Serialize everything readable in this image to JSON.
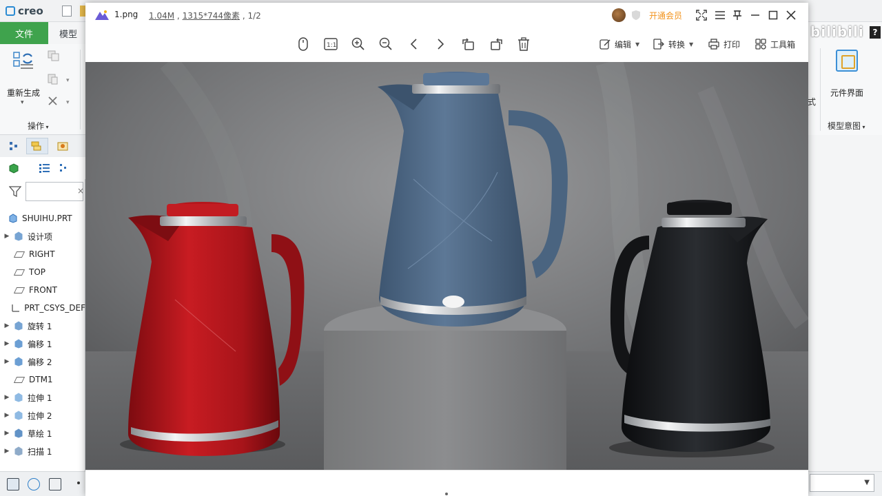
{
  "creo": {
    "app_name": "creo",
    "tabs": {
      "file": "文件",
      "model": "模型"
    },
    "ribbon": {
      "regenerate": "重新生成",
      "operations_group": "操作",
      "component_interface": "元件界面",
      "model_intent": "模型意图",
      "partial_label": "式"
    },
    "watermark": "bilibili",
    "help": "?",
    "tree": {
      "filter_placeholder": "",
      "root": "SHUIHU.PRT",
      "items": [
        {
          "label": "设计项",
          "expandable": true,
          "icon": "design-items-icon"
        },
        {
          "label": "RIGHT",
          "expandable": false,
          "icon": "datum-plane-icon"
        },
        {
          "label": "TOP",
          "expandable": false,
          "icon": "datum-plane-icon"
        },
        {
          "label": "FRONT",
          "expandable": false,
          "icon": "datum-plane-icon"
        },
        {
          "label": "PRT_CSYS_DEF",
          "expandable": false,
          "icon": "csys-icon"
        },
        {
          "label": "旋转 1",
          "expandable": true,
          "icon": "revolve-icon"
        },
        {
          "label": "偏移 1",
          "expandable": true,
          "icon": "offset-icon"
        },
        {
          "label": "偏移 2",
          "expandable": true,
          "icon": "offset-icon"
        },
        {
          "label": "DTM1",
          "expandable": false,
          "icon": "datum-plane-icon"
        },
        {
          "label": "拉伸 1",
          "expandable": true,
          "icon": "extrude-icon"
        },
        {
          "label": "拉伸 2",
          "expandable": true,
          "icon": "extrude-icon"
        },
        {
          "label": "草绘 1",
          "expandable": true,
          "icon": "sketch-icon"
        },
        {
          "label": "扫描 1",
          "expandable": true,
          "icon": "sweep-icon"
        }
      ]
    }
  },
  "viewer": {
    "filename": "1.png",
    "filesize": "1.04M",
    "dimensions": "1315*744像素",
    "page_index": "1/2",
    "vip_label": "开通会员",
    "toolbar": {
      "edit": "编辑",
      "convert": "转换",
      "print": "打印",
      "toolbox": "工具箱"
    },
    "image": {
      "subject": "three electric kettles on display",
      "kettles": [
        {
          "color_name": "red",
          "body": "#b3161c"
        },
        {
          "color_name": "blue-gray",
          "body": "#4f6a86"
        },
        {
          "color_name": "black",
          "body": "#16181b"
        }
      ]
    }
  }
}
